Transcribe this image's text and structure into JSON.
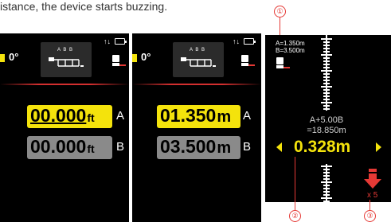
{
  "caption": "istance, the device starts buzzing.",
  "callouts": [
    "①",
    "②",
    "③"
  ],
  "panel1": {
    "angle": "0°",
    "graphic_letters": "A B B",
    "value_a": "00.000",
    "unit_a": "ft",
    "label_a": "A",
    "value_b": "00.000",
    "unit_b": "ft",
    "label_b": "B",
    "status": "↑↓"
  },
  "panel2": {
    "angle": "0°",
    "graphic_letters": "A B B",
    "value_a": "01.350",
    "unit_a": "m",
    "label_a": "A",
    "value_b": "03.500",
    "unit_b": "m",
    "label_b": "B",
    "status": "↑↓"
  },
  "panel3": {
    "a_value": "A=1.350m",
    "b_value": "B=3.500m",
    "formula_line1": "A+5.00B",
    "formula_line2": "=18.850m",
    "result": "0.328m",
    "multiplier": "x 5"
  },
  "colors": {
    "highlight": "#f4e30c",
    "inactive_box": "#8a8a8a",
    "accent_red": "#e53935",
    "panel_bg": "#000000"
  },
  "icons": [
    "battery-icon",
    "signal-arrows-icon",
    "device-icon",
    "left-arrow-icon",
    "right-arrow-icon",
    "down-arrow-icon"
  ]
}
